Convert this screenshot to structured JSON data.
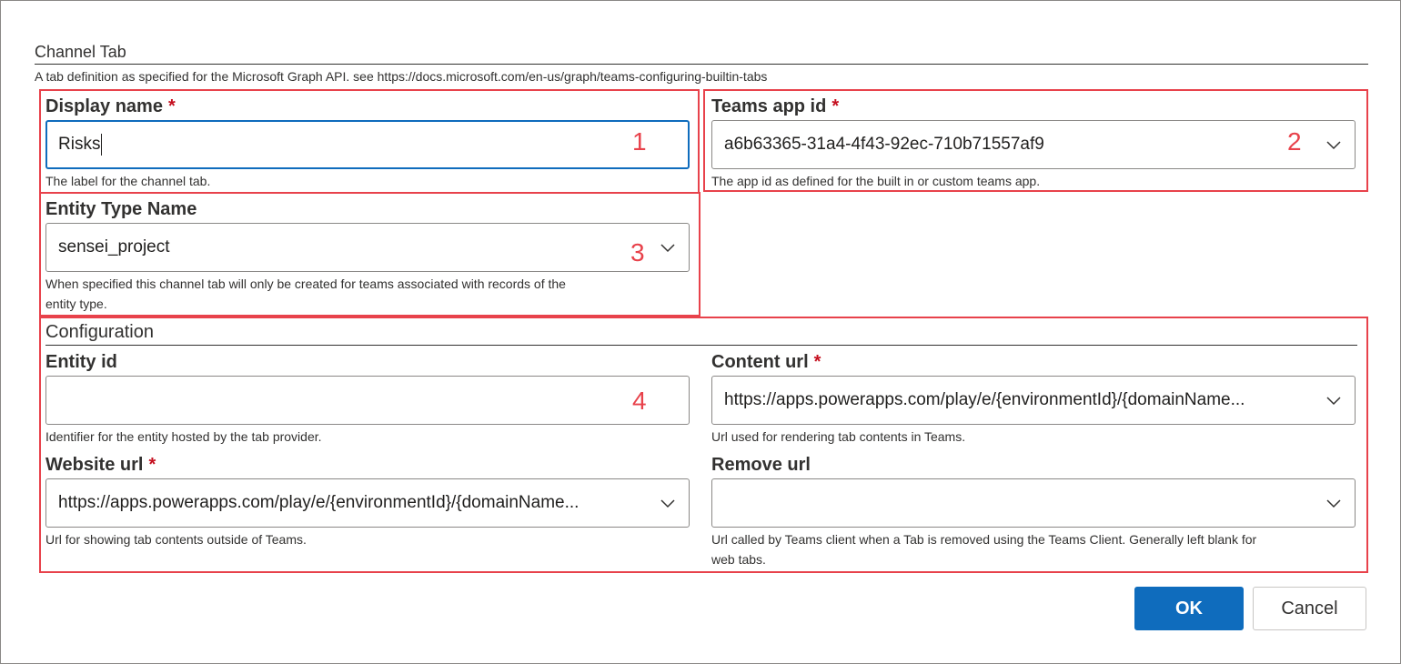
{
  "header": {
    "title": "Channel Tab",
    "description": "A tab definition as specified for the Microsoft Graph API. see https://docs.microsoft.com/en-us/graph/teams-configuring-builtin-tabs"
  },
  "fields": {
    "display_name": {
      "label": "Display name",
      "required": "*",
      "value": "Risks",
      "description": "The label for the channel tab."
    },
    "teams_app_id": {
      "label": "Teams app id",
      "required": "*",
      "value": "a6b63365-31a4-4f43-92ec-710b71557af9",
      "description": "The app id as defined for the built in or custom teams app."
    },
    "entity_type_name": {
      "label": "Entity Type Name",
      "value": "sensei_project",
      "description_line1": "When specified this channel tab will only be created for teams associated with records of the",
      "description_line2": "entity type."
    }
  },
  "configuration": {
    "title": "Configuration",
    "entity_id": {
      "label": "Entity id",
      "value": "",
      "description": "Identifier for the entity hosted by the tab provider."
    },
    "content_url": {
      "label": "Content url",
      "required": "*",
      "value": "https://apps.powerapps.com/play/e/{environmentId}/{domainName...",
      "description": "Url used for rendering tab contents in Teams."
    },
    "website_url": {
      "label": "Website url",
      "required": "*",
      "value": "https://apps.powerapps.com/play/e/{environmentId}/{domainName...",
      "description": "Url for showing tab contents outside of Teams."
    },
    "remove_url": {
      "label": "Remove url",
      "value": "",
      "description_line1": "Url called by Teams client when a Tab is removed using the Teams Client. Generally left blank for",
      "description_line2": "web tabs."
    }
  },
  "annotations": {
    "n1": "1",
    "n2": "2",
    "n3": "3",
    "n4": "4",
    "color": "#e8424b"
  },
  "buttons": {
    "ok": "OK",
    "cancel": "Cancel"
  },
  "colors": {
    "primary": "#0f6cbd",
    "required": "#c50f1f"
  }
}
